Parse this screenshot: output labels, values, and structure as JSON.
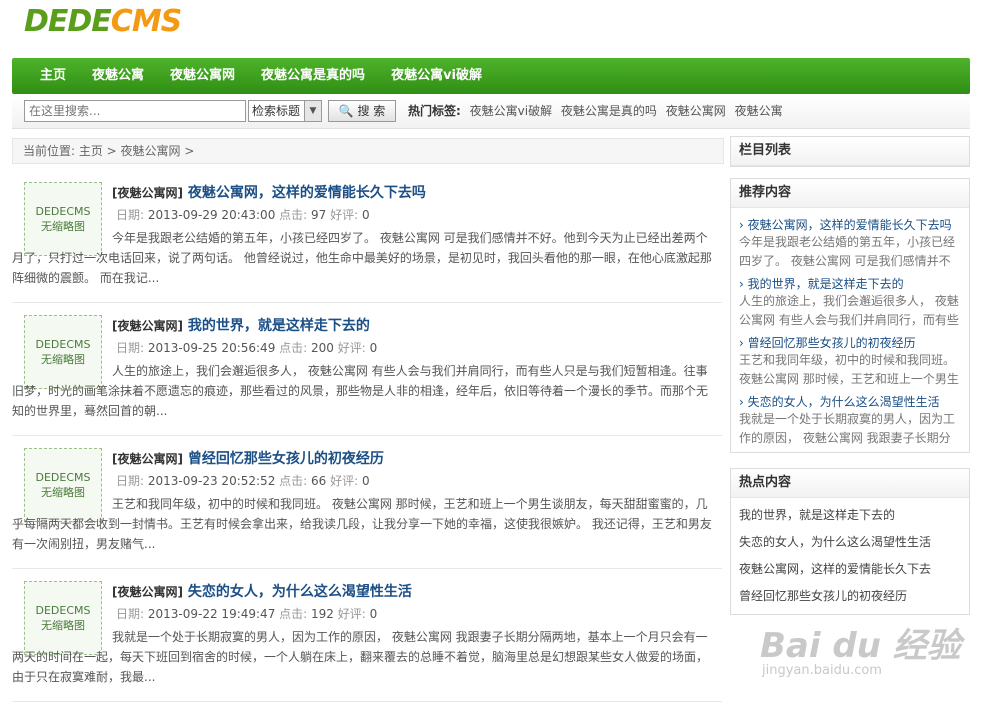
{
  "logo": {
    "part1": "DEDE",
    "part2": "CMS"
  },
  "nav": [
    "主页",
    "夜魅公寓",
    "夜魅公寓网",
    "夜魅公寓是真的吗",
    "夜魅公寓vi破解"
  ],
  "search": {
    "placeholder": "在这里搜索...",
    "select_value": "检索标题",
    "button": "搜 索",
    "hot_label": "热门标签:",
    "tags": [
      "夜魅公寓vi破解",
      "夜魅公寓是真的吗",
      "夜魅公寓网",
      "夜魅公寓"
    ]
  },
  "breadcrumb": "当前位置: 主页 > 夜魅公寓网 >",
  "thumb": {
    "line1": "DEDECMS",
    "line2": "无缩略图"
  },
  "articles": [
    {
      "cat": "[夜魅公寓网]",
      "title": "夜魅公寓网，这样的爱情能长久下去吗",
      "date_label": "日期:",
      "date": "2013-09-29 20:43:00",
      "clicks_label": "点击:",
      "clicks": "97",
      "comments_label": "好评:",
      "comments": "0",
      "desc": "今年是我跟老公结婚的第五年，小孩已经四岁了。 夜魅公寓网 可是我们感情并不好。他到今天为止已经出差两个月了，只打过一次电话回来，说了两句话。 他曾经说过，他生命中最美好的场景，是初见时，我回头看他的那一眼，在他心底激起那阵细微的震颤。 而在我记..."
    },
    {
      "cat": "[夜魅公寓网]",
      "title": "我的世界，就是这样走下去的",
      "date_label": "日期:",
      "date": "2013-09-25 20:56:49",
      "clicks_label": "点击:",
      "clicks": "200",
      "comments_label": "好评:",
      "comments": "0",
      "desc": "人生的旅途上，我们会邂逅很多人， 夜魅公寓网 有些人会与我们并肩同行，而有些人只是与我们短暂相逢。往事旧梦，时光的画笔涂抹着不愿遗忘的痕迹，那些看过的风景，那些物是人非的相逢，经年后，依旧等待着一个漫长的季节。而那个无知的世界里，蓦然回首的朝..."
    },
    {
      "cat": "[夜魅公寓网]",
      "title": "曾经回忆那些女孩儿的初夜经历",
      "date_label": "日期:",
      "date": "2013-09-23 20:52:52",
      "clicks_label": "点击:",
      "clicks": "66",
      "comments_label": "好评:",
      "comments": "0",
      "desc": "王艺和我同年级，初中的时候和我同班。 夜魅公寓网 那时候，王艺和班上一个男生谈朋友，每天甜甜蜜蜜的，几乎每隔两天都会收到一封情书。王艺有时候会拿出来，给我读几段，让我分享一下她的幸福，这使我很嫉妒。 我还记得，王艺和男友有一次闹别扭，男友赌气..."
    },
    {
      "cat": "[夜魅公寓网]",
      "title": "失恋的女人，为什么这么渴望性生活",
      "date_label": "日期:",
      "date": "2013-09-22 19:49:47",
      "clicks_label": "点击:",
      "clicks": "192",
      "comments_label": "好评:",
      "comments": "0",
      "desc": "我就是一个处于长期寂寞的男人，因为工作的原因， 夜魅公寓网 我跟妻子长期分隔两地，基本上一个月只会有一两天的时间在一起，每天下班回到宿舍的时候，一个人躺在床上，翻来覆去的总睡不着觉，脑海里总是幻想跟某些女人做爱的场面，由于只在寂寞难耐，我最..."
    }
  ],
  "sidebar": {
    "column_title": "栏目列表",
    "recommend_title": "推荐内容",
    "recommend": [
      {
        "title": "› 夜魅公寓网，这样的爱情能长久下去吗",
        "desc": "今年是我跟老公结婚的第五年，小孩已经四岁了。 夜魅公寓网 可是我们感情并不"
      },
      {
        "title": "› 我的世界，就是这样走下去的",
        "desc": "人生的旅途上，我们会邂逅很多人， 夜魅公寓网 有些人会与我们并肩同行，而有些"
      },
      {
        "title": "› 曾经回忆那些女孩儿的初夜经历",
        "desc": "王艺和我同年级，初中的时候和我同班。 夜魅公寓网 那时候，王艺和班上一个男生"
      },
      {
        "title": "› 失恋的女人，为什么这么渴望性生活",
        "desc": "我就是一个处于长期寂寞的男人，因为工作的原因， 夜魅公寓网 我跟妻子长期分"
      }
    ],
    "hot_title": "热点内容",
    "hot": [
      "我的世界，就是这样走下去的",
      "失恋的女人，为什么这么渴望性生活",
      "夜魅公寓网，这样的爱情能长久下去",
      "曾经回忆那些女孩儿的初夜经历"
    ]
  },
  "watermark": {
    "line1": "Bai du 经验",
    "line2": "jingyan.baidu.com"
  }
}
